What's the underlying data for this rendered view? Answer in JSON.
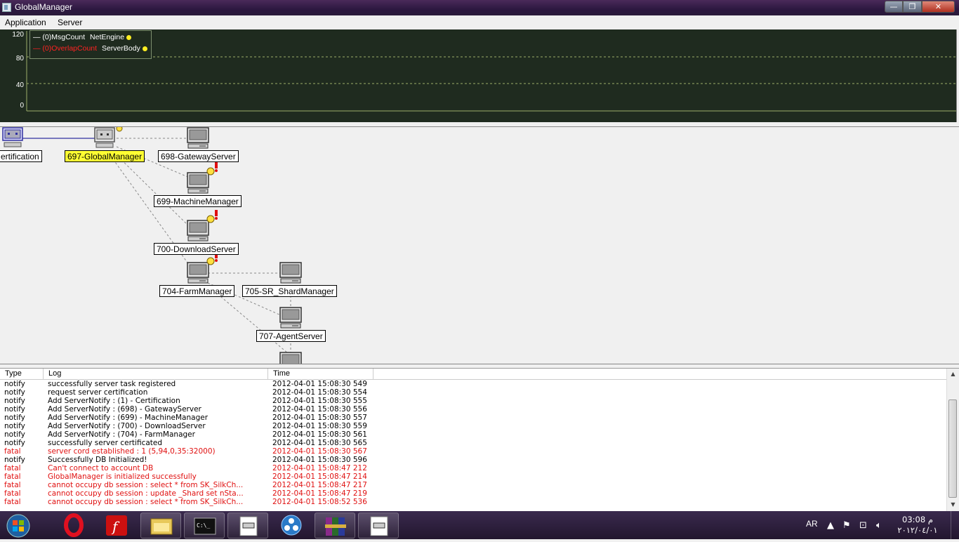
{
  "window": {
    "title": "GlobalManager",
    "controls": {
      "minimize": "—",
      "maximize": "❐",
      "close": "✕"
    }
  },
  "menu": {
    "items": [
      "Application",
      "Server"
    ]
  },
  "graph": {
    "y_ticks": [
      "120",
      "80",
      "40",
      "0"
    ],
    "legend": [
      {
        "text": "— (0)MsgCount",
        "tag": "NetEngine",
        "color": "#ffffff"
      },
      {
        "text": "— (0)OverlapCount",
        "tag": "ServerBody",
        "color": "#ff2222"
      }
    ],
    "background": "#1f2b1f"
  },
  "topology": {
    "nodes": [
      {
        "id": "certification",
        "label": "ertification",
        "selected": false
      },
      {
        "id": "global",
        "label": "697-GlobalManager",
        "selected": true
      },
      {
        "id": "gateway",
        "label": "698-GatewayServer",
        "selected": false
      },
      {
        "id": "machine",
        "label": "699-MachineManager",
        "selected": false
      },
      {
        "id": "download",
        "label": "700-DownloadServer",
        "selected": false
      },
      {
        "id": "farm",
        "label": "704-FarmManager",
        "selected": false
      },
      {
        "id": "shard",
        "label": "705-SR_ShardManager",
        "selected": false
      },
      {
        "id": "agent",
        "label": "707-AgentServer",
        "selected": false
      }
    ]
  },
  "log": {
    "columns": [
      "Type",
      "Log",
      "Time"
    ],
    "rows": [
      {
        "type": "notify",
        "log": "successfully server task registered",
        "time": "2012-04-01 15:08:30 549"
      },
      {
        "type": "notify",
        "log": "request server certification",
        "time": "2012-04-01 15:08:30 554"
      },
      {
        "type": "notify",
        "log": "Add ServerNotify : (1) - Certification",
        "time": "2012-04-01 15:08:30 555"
      },
      {
        "type": "notify",
        "log": "Add ServerNotify : (698) - GatewayServer",
        "time": "2012-04-01 15:08:30 556"
      },
      {
        "type": "notify",
        "log": "Add ServerNotify : (699) - MachineManager",
        "time": "2012-04-01 15:08:30 557"
      },
      {
        "type": "notify",
        "log": "Add ServerNotify : (700) - DownloadServer",
        "time": "2012-04-01 15:08:30 559"
      },
      {
        "type": "notify",
        "log": "Add ServerNotify : (704) - FarmManager",
        "time": "2012-04-01 15:08:30 561"
      },
      {
        "type": "notify",
        "log": "successfully server certificated",
        "time": "2012-04-01 15:08:30 565"
      },
      {
        "type": "fatal",
        "log": "server cord established : 1 (5,94,0,35:32000)",
        "time": "2012-04-01 15:08:30 567"
      },
      {
        "type": "notify",
        "log": "Successfully DB Initialized!",
        "time": "2012-04-01 15:08:30 596"
      },
      {
        "type": "fatal",
        "log": "Can't connect to account DB",
        "time": "2012-04-01 15:08:47 212"
      },
      {
        "type": "fatal",
        "log": "GlobalManager is initialized successfully",
        "time": "2012-04-01 15:08:47 214"
      },
      {
        "type": "fatal",
        "log": "cannot occupy db session : select * from SK_SilkCh...",
        "time": "2012-04-01 15:08:47 217"
      },
      {
        "type": "fatal",
        "log": "cannot occupy db session : update _Shard set nSta...",
        "time": "2012-04-01 15:08:47 219"
      },
      {
        "type": "fatal",
        "log": "cannot occupy db session : select * from SK_SilkCh...",
        "time": "2012-04-01 15:08:52 536"
      }
    ],
    "colors": {
      "fatal": "#e01010",
      "notify": "#000000"
    }
  },
  "taskbar": {
    "apps": [
      "start-orb",
      "opera-icon",
      "flash-icon",
      "explorer-icon",
      "cmd-icon",
      "app-window-icon",
      "network-icon",
      "winrar-icon",
      "app-window-icon"
    ],
    "tray": {
      "language": "AR",
      "time": "03:08 م",
      "date": "٢٠١٢/٠٤/٠١"
    }
  }
}
